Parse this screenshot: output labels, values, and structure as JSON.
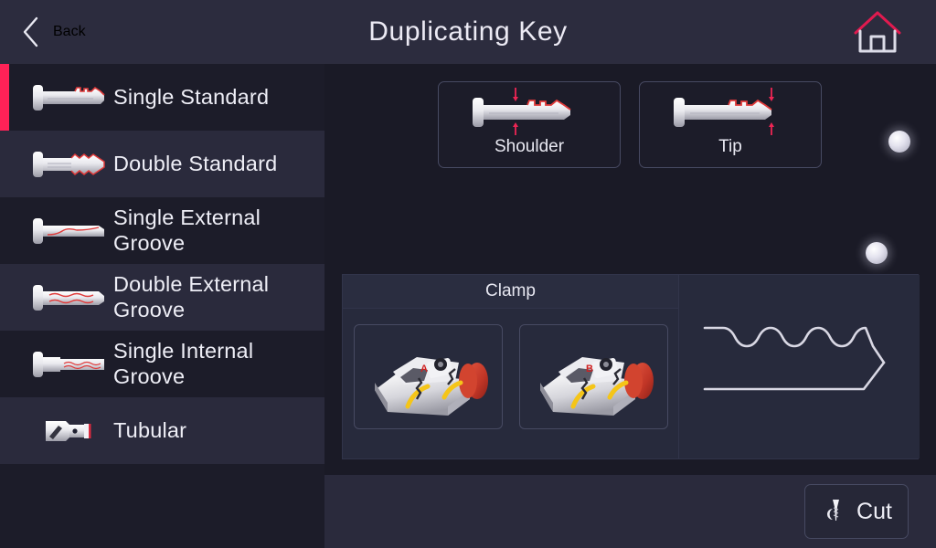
{
  "header": {
    "back_label": "Back",
    "title": "Duplicating Key",
    "back_icon": "chevron-left-icon",
    "home_icon": "home-icon"
  },
  "sidebar": {
    "selected_index": 0,
    "items": [
      {
        "label": "Single Standard",
        "icon": "key-single-standard-icon",
        "selected": true
      },
      {
        "label": "Double Standard",
        "icon": "key-double-standard-icon",
        "selected": false
      },
      {
        "label": "Single External\nGroove",
        "icon": "key-single-external-groove-icon",
        "selected": false
      },
      {
        "label": "Double External\nGroove",
        "icon": "key-double-external-groove-icon",
        "selected": false
      },
      {
        "label": "Single Internal\nGroove",
        "icon": "key-single-internal-groove-icon",
        "selected": false
      },
      {
        "label": "Tubular",
        "icon": "key-tubular-icon",
        "selected": false
      }
    ]
  },
  "main": {
    "reference_modes": [
      {
        "label": "Shoulder",
        "icon": "key-shoulder-reference-icon"
      },
      {
        "label": "Tip",
        "icon": "key-tip-reference-icon"
      }
    ],
    "indicators": [
      {
        "name": "indicator-dot-1",
        "state": "on"
      },
      {
        "name": "indicator-dot-2",
        "state": "on"
      }
    ],
    "clamp": {
      "title": "Clamp",
      "options": [
        {
          "side_label": "A",
          "icon": "clamp-jaw-a-icon"
        },
        {
          "side_label": "B",
          "icon": "clamp-jaw-b-icon"
        }
      ]
    },
    "key_profile": {
      "name": "key-blade-profile-preview",
      "cut_count": 5
    }
  },
  "bottom": {
    "cut_label": "Cut",
    "cut_icon": "milling-cutter-icon"
  },
  "colors": {
    "accent": "#ff2257",
    "header_bg": "#2c2c3e",
    "page_bg": "#1a1a26",
    "row_alt_bg": "#2a2a3c",
    "row_bg": "#1c1c29",
    "panel_bg": "#272a3c",
    "border": "#474a62",
    "text": "#eeeef6"
  }
}
